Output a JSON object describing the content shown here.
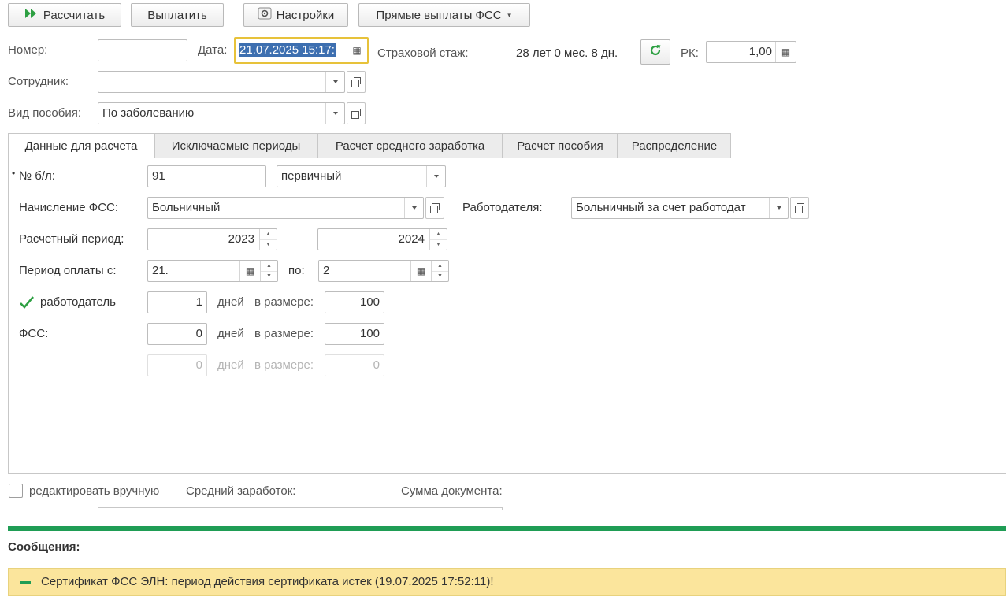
{
  "toolbar": {
    "calculate_label": "Рассчитать",
    "pay_label": "Выплатить",
    "settings_label": "Настройки",
    "direct_payments_label": "Прямые выплаты ФСС"
  },
  "header": {
    "number_label": "Номер:",
    "number_value": "",
    "date_label": "Дата:",
    "date_value": "21.07.2025 15:17:",
    "insurance_label": "Страховой стаж:",
    "insurance_value": "28 лет 0 мес. 8 дн.",
    "rk_label": "РК:",
    "rk_value": "1,00",
    "employee_label": "Сотрудник:",
    "employee_value": "",
    "benefit_type_label": "Вид пособия:",
    "benefit_type_value": "По заболеванию"
  },
  "tabs": [
    {
      "label": "Данные для расчета"
    },
    {
      "label": "Исключаемые периоды"
    },
    {
      "label": "Расчет среднего заработка"
    },
    {
      "label": "Расчет пособия"
    },
    {
      "label": "Распределение"
    }
  ],
  "form": {
    "sick_leave_label": "№ б/л:",
    "sick_leave_number": "91",
    "sick_leave_type": "первичный",
    "fss_accrual_label": "Начисление ФСС:",
    "fss_accrual_value": "Больничный",
    "employer_label": "Работодателя:",
    "employer_value": "Больничный за счет работодат",
    "calc_period_label": "Расчетный период:",
    "calc_period_from": "2023",
    "calc_period_to": "2024",
    "pay_period_label": "Период оплаты с:",
    "pay_period_from": "21.",
    "pay_period_to_label": "по:",
    "pay_period_to": "2",
    "employer_check_label": "работодатель",
    "employer_check_checked": true,
    "employer_days": "1",
    "days_label": "дней",
    "amount_label": "в размере:",
    "employer_amount": "100",
    "fss_label": "ФСС:",
    "fss_days": "0",
    "fss_amount": "100",
    "extra_days": "0",
    "extra_amount": "0"
  },
  "footer": {
    "manual_edit_label": "редактировать вручную",
    "avg_earnings_label": "Средний заработок:",
    "doc_sum_label": "Сумма документа:"
  },
  "messages": {
    "title": "Сообщения:",
    "items": [
      {
        "text": "Сертификат ФСС ЭЛН: период действия сертификата истек (19.07.2025 17:52:11)!"
      }
    ]
  },
  "colors": {
    "accent_green": "#1f9d55",
    "date_focus_border": "#e7c23a",
    "message_bg": "#fbe59c",
    "selection_bg": "#3d6fb0"
  }
}
